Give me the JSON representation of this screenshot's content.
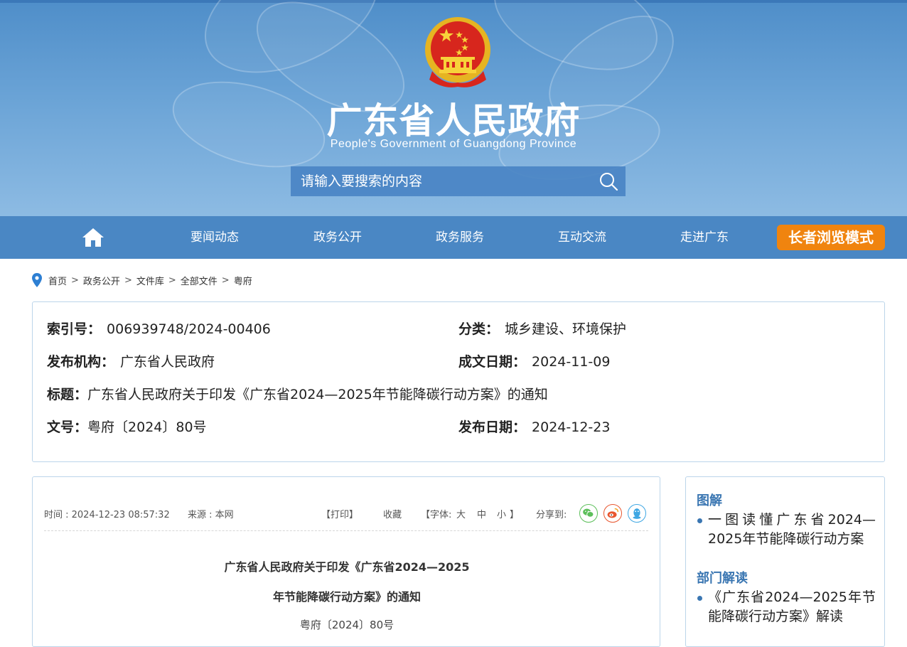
{
  "header": {
    "title": "广东省人民政府",
    "subtitle": "People's Government of Guangdong Province",
    "search_placeholder": "请输入要搜索的内容",
    "emblem_icon": "national-emblem-icon",
    "search_icon": "search-icon"
  },
  "nav": {
    "home_icon": "home-icon",
    "items": [
      "要闻动态",
      "政务公开",
      "政务服务",
      "互动交流",
      "走进广东"
    ],
    "elder_mode": "长者浏览模式",
    "elder_color": "#f0840f"
  },
  "breadcrumb": {
    "items": [
      "首页",
      "政务公开",
      "文件库",
      "全部文件",
      "粤府"
    ],
    "separator": ">"
  },
  "info": {
    "index_label": "索引号：",
    "index_value": "006939748/2024-00406",
    "category_label": "分类：",
    "category_value": "城乡建设、环境保护",
    "publisher_label": "发布机构：",
    "publisher_value": "广东省人民政府",
    "written_date_label": "成文日期：",
    "written_date_value": "2024-11-09",
    "title_label": "标题：",
    "title_value": "广东省人民政府关于印发《广东省2024—2025年节能降碳行动方案》的通知",
    "doc_no_label": "文号：",
    "doc_no_value": "粤府〔2024〕80号",
    "publish_date_label": "发布日期：",
    "publish_date_value": "2024-12-23"
  },
  "article": {
    "time": "时间 : 2024-12-23 08:57:32",
    "source": "来源 : 本网",
    "print": "【打印】",
    "favorite": "收藏",
    "font_label": "【字体:",
    "font_large": "大",
    "font_medium": "中",
    "font_small": "小",
    "font_close": "】",
    "share_label": "分享到:",
    "share_icons": [
      "wechat-icon",
      "weibo-icon",
      "qq-icon"
    ],
    "title_line1": "广东省人民政府关于印发《广东省2024—2025",
    "title_line2": "年节能降碳行动方案》的通知",
    "doc_no": "粤府〔2024〕80号"
  },
  "side": {
    "section1_heading": "图解",
    "section1_link": "一图读懂广东省2024—2025年节能降碳行动方案",
    "section2_heading": "部门解读",
    "section2_link": "《广东省2024—2025年节能降碳行动方案》解读"
  },
  "colors": {
    "header_blue": "#4f8ec9",
    "nav_blue": "#4a87c4",
    "accent_blue": "#3a76b2",
    "border": "#bcd5ea"
  }
}
